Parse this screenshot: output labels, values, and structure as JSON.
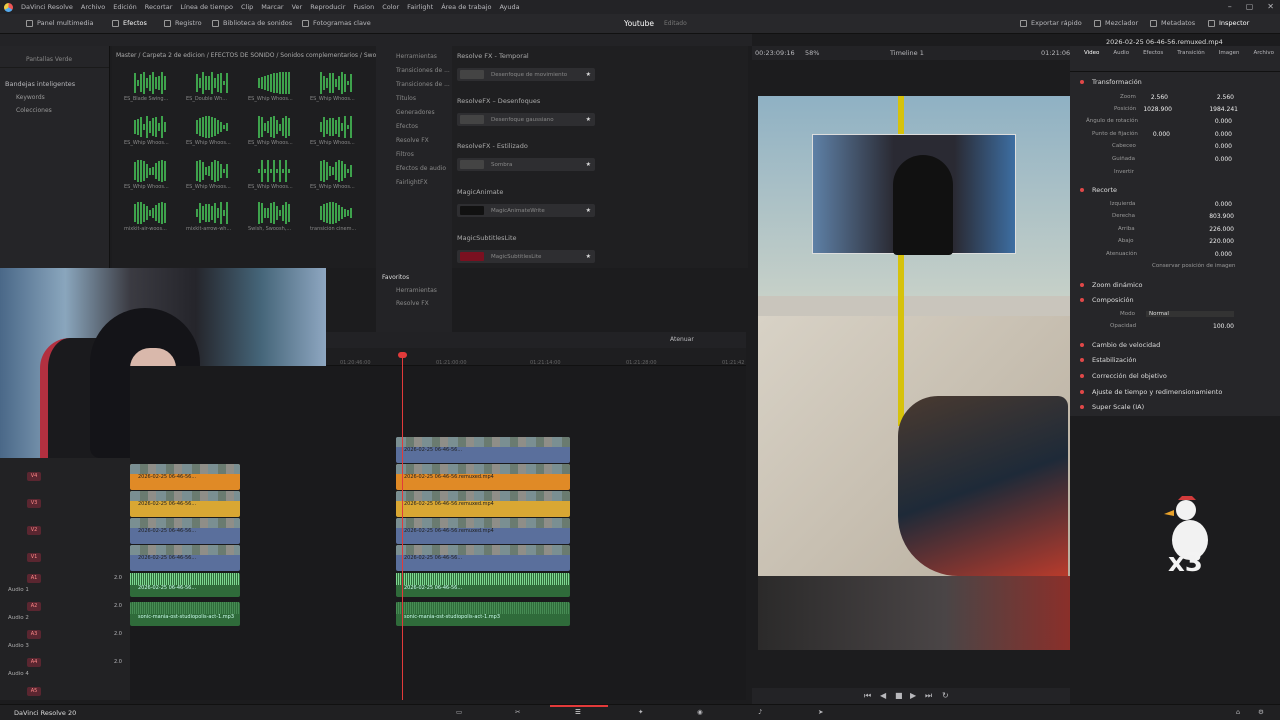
{
  "menubar": {
    "items": [
      "DaVinci Resolve",
      "Archivo",
      "Edición",
      "Recortar",
      "Línea de tiempo",
      "Clip",
      "Marcar",
      "Ver",
      "Reproducir",
      "Fusion",
      "Color",
      "Fairlight",
      "Área de trabajo",
      "Ayuda"
    ]
  },
  "toolbar": {
    "panel": "Panel multimedia",
    "effects": "Efectos",
    "registro": "Registro",
    "sound_lib": "Biblioteca de sonidos",
    "keyframes": "Fotogramas clave",
    "project": "Youtube",
    "project_state": "Editado",
    "export": "Exportar rápido",
    "mixer": "Mezclador",
    "metadata": "Metadatos",
    "inspector": "Inspector"
  },
  "left": {
    "header": "Pantallas Verde",
    "smart_bins": "Bandejas inteligentes",
    "keywords": "Keywords",
    "collections": "Colecciones"
  },
  "media": {
    "breadcrumb": "Master / Carpeta 2 de edicion / EFECTOS DE SONIDO / Sonidos complementarios / Swoosh",
    "items": [
      "ES_Blade Swing...",
      "ES_Double Wh...",
      "ES_Whip Whoos...",
      "ES_Whip Whoos...",
      "ES_Whip Whoos...",
      "ES_Whip Whoos...",
      "ES_Whip Whoos...",
      "ES_Whip Whoos...",
      "ES_Whip Whoos...",
      "ES_Whip Whoos...",
      "ES_Whip Whoos...",
      "ES_Whip Whoos...",
      "mixkit-air-woos...",
      "mixkit-arrow-wh...",
      "Swish, Swoosh,...",
      "transición cinem..."
    ]
  },
  "fxtree": {
    "items": [
      "Herramientas",
      "Transiciones de ...",
      "Transiciones de ...",
      "Títulos",
      "Generadores",
      "Efectos",
      "Resolve FX",
      "Filtros",
      "Efectos de audio",
      "FairlightFX"
    ]
  },
  "fx": {
    "sec1": "Resolve FX - Temporal",
    "i1": "Desenfoque de movimiento",
    "sec2": "ResolveFX – Desenfoques",
    "i2": "Desenfoque gaussiano",
    "sec3": "ResolveFX - Estilizado",
    "i3": "Sombra",
    "sec4": "MagicAnimate",
    "i4": "MagicAnimateWrite",
    "sec5": "MagicSubtitlesLite",
    "i5": "MagicSubtitlesLite"
  },
  "favs": {
    "title": "Favoritos",
    "a": "Herramientas",
    "b": "Resolve FX"
  },
  "timeline": {
    "ticks": [
      "01:20:46:00",
      "01:21:00:00",
      "01:21:14:00",
      "01:21:28:00",
      "01:21:42"
    ],
    "mute": "Atenuar",
    "clip_label": "2026-02-25 06-46-56.remuxed.mp4",
    "clip_short": "2026-02-25 06-46-56...",
    "audio_label": "sonic-mania-ost-studiopolis-act-1.mp3"
  },
  "tracks": [
    {
      "id": "V4"
    },
    {
      "id": "V3"
    },
    {
      "id": "V2"
    },
    {
      "id": "V1"
    },
    {
      "id": "A1",
      "name": "Audio 1",
      "vol": "2.0"
    },
    {
      "id": "A2",
      "name": "Audio 2",
      "vol": "2.0"
    },
    {
      "id": "A3",
      "name": "Audio 3",
      "vol": "2.0"
    },
    {
      "id": "A4",
      "name": "Audio 4",
      "vol": "2.0"
    },
    {
      "id": "A5"
    }
  ],
  "viewer": {
    "tc": "00:23:09:16",
    "zoom": "58%",
    "timeline": "Timeline 1",
    "tc2": "01:21:06:06",
    "filename": "2026-02-25 06-46-56.remuxed.mp4"
  },
  "inspector": {
    "tabs": [
      "Video",
      "Audio",
      "Efectos",
      "Transición",
      "Imagen",
      "Archivo"
    ],
    "transform": "Transformación",
    "zoom": "Zoom",
    "zx": "2.560",
    "zy": "2.560",
    "pos": "Posición",
    "px": "1028.900",
    "py": "1984.241",
    "rot": "Ángulo de rotación",
    "rotv": "0.000",
    "anchor": "Punto de fijación",
    "ax": "0.000",
    "ay": "0.000",
    "pitch": "Cabeceo",
    "pitchv": "0.000",
    "yaw": "Guiñada",
    "yawv": "0.000",
    "flip": "Invertir",
    "crop": "Recorte",
    "left": "Izquierda",
    "leftv": "0.000",
    "right": "Derecha",
    "rightv": "803.900",
    "top": "Arriba",
    "topv": "226.000",
    "bottom": "Abajo",
    "bottomv": "220.000",
    "soft": "Atenuación",
    "softv": "0.000",
    "keep": "Conservar posición de imagen",
    "dynzoom": "Zoom dinámico",
    "comp": "Composición",
    "mode": "Modo",
    "modev": "Normal",
    "opacity": "Opacidad",
    "opv": "100.00",
    "speed": "Cambio de velocidad",
    "stab": "Estabilización",
    "lens": "Corrección del objetivo",
    "retime": "Ajuste de tiempo y redimensionamiento",
    "superscale": "Super Scale (IA)"
  },
  "duck": {
    "count": "x3"
  },
  "status": {
    "app": "DaVinci Resolve 20"
  }
}
